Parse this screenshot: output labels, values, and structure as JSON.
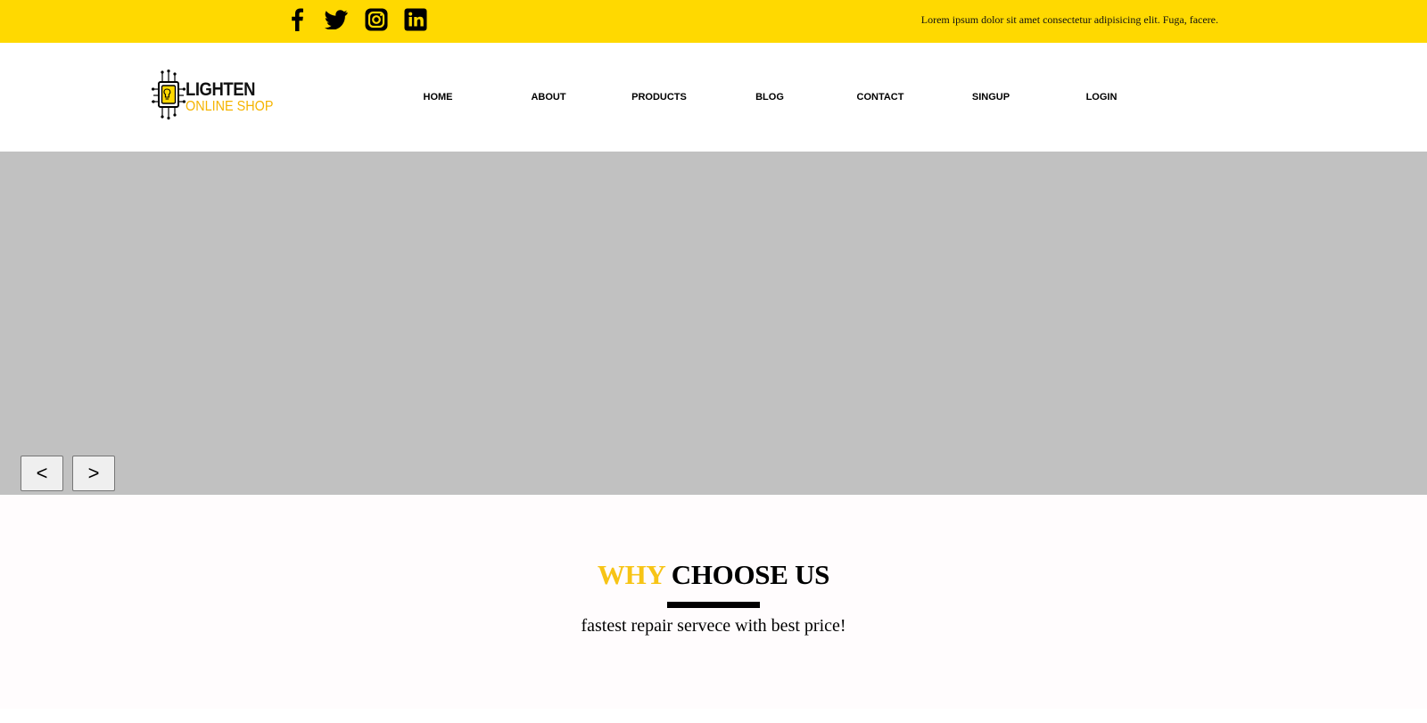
{
  "topbar": {
    "background": "#ffd900",
    "social_icons": [
      "facebook-icon",
      "twitter-icon",
      "instagram-icon",
      "linkedin-icon"
    ],
    "tagline": "Lorem ipsum dolor sit amet consectetur adipisicing elit. Fuga, facere."
  },
  "logo": {
    "title": "LIGHTEN",
    "subtitle": "ONLINE SHOP",
    "icon": "circuit-chip-icon",
    "subtitle_color": "#f5b400"
  },
  "nav": {
    "home": "HOME",
    "about": "ABOUT",
    "products": "PRODUCTS",
    "blog": "BLOG",
    "contact": "CONTACT",
    "signup": "SINGUP",
    "login": "LOGIN"
  },
  "hero": {
    "background": "#c1c1c1",
    "prev_label": "<",
    "next_label": ">"
  },
  "why": {
    "title_accent": "WHY",
    "title_rest": "CHOOSE US",
    "subtitle": "fastest repair servece with best price!",
    "accent_color": "#f7c416"
  }
}
